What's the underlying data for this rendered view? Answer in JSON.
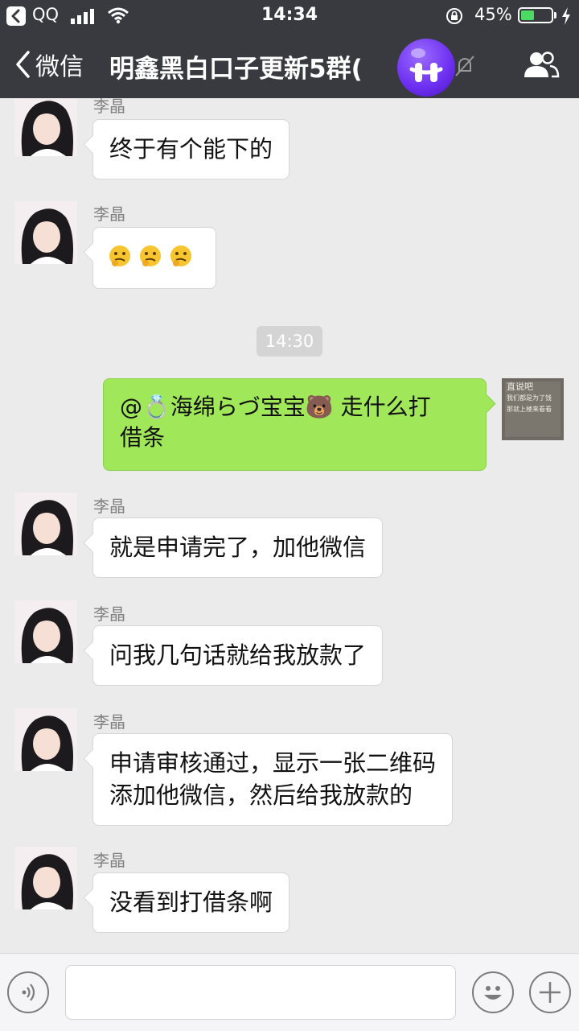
{
  "status_bar": {
    "carrier": "QQ",
    "time": "14:34",
    "battery_percent": "45%",
    "battery_level": 0.45
  },
  "nav": {
    "back_label": "微信",
    "title": "明鑫黑白口子更新5群(",
    "badge_icon": "purple-face-sticker-icon"
  },
  "colors": {
    "header_bg": "#393a3f",
    "chat_bg": "#ebebeb",
    "bubble_self": "#a0e75a",
    "bubble_other": "#ffffff"
  },
  "messages": [
    {
      "sender": "李晶",
      "text": "终于有个能下的"
    },
    {
      "sender": "李晶",
      "emoji": "thinking-face-icon ×3"
    },
    {
      "timestamp": "14:30"
    },
    {
      "self": true,
      "text_line1": "@💍海绵らづ宝宝🐻 走什么打",
      "text_line2": "借条"
    },
    {
      "sender": "李晶",
      "text": "就是申请完了，加他微信"
    },
    {
      "sender": "李晶",
      "text": "问我几句话就给我放款了"
    },
    {
      "sender": "李晶",
      "text_line1": "申请审核通过，显示一张二维码",
      "text_line2": "添加他微信，然后给我放款的"
    },
    {
      "sender": "李晶",
      "text": "没看到打借条啊"
    }
  ],
  "self_avatar": {
    "line1": "直说吧",
    "line2": "我们都是为了钱",
    "line3": "那就上楼来看看"
  },
  "input": {
    "placeholder": ""
  }
}
